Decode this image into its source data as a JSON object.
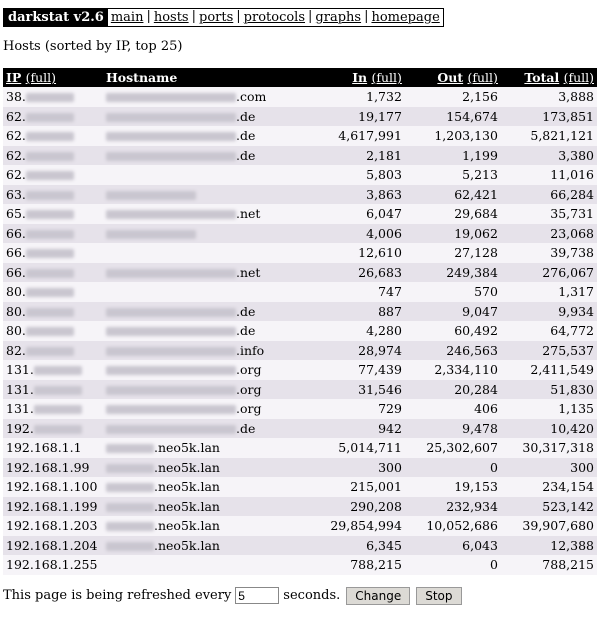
{
  "nav": {
    "brand": "darkstat v2.6",
    "links": [
      "main",
      "hosts",
      "ports",
      "protocols",
      "graphs",
      "homepage"
    ]
  },
  "heading": "Hosts (sorted by IP, top 25)",
  "table": {
    "headers": {
      "ip": "IP",
      "hostname": "Hostname",
      "in": "In",
      "out": "Out",
      "total": "Total",
      "full": "(full)"
    },
    "rows": [
      {
        "ip": "38.",
        "host": ".com",
        "in": "1,732",
        "out": "2,156",
        "total": "3,888"
      },
      {
        "ip": "62.",
        "host": ".de",
        "in": "19,177",
        "out": "154,674",
        "total": "173,851"
      },
      {
        "ip": "62.",
        "host": ".de",
        "in": "4,617,991",
        "out": "1,203,130",
        "total": "5,821,121"
      },
      {
        "ip": "62.",
        "host": ".de",
        "in": "2,181",
        "out": "1,199",
        "total": "3,380"
      },
      {
        "ip": "62.",
        "host": "",
        "in": "5,803",
        "out": "5,213",
        "total": "11,016"
      },
      {
        "ip": "63.",
        "host": "",
        "in": "3,863",
        "out": "62,421",
        "total": "66,284"
      },
      {
        "ip": "65.",
        "host": ".net",
        "in": "6,047",
        "out": "29,684",
        "total": "35,731"
      },
      {
        "ip": "66.",
        "host": "",
        "in": "4,006",
        "out": "19,062",
        "total": "23,068"
      },
      {
        "ip": "66.",
        "host": "",
        "in": "12,610",
        "out": "27,128",
        "total": "39,738"
      },
      {
        "ip": "66.",
        "host": ".net",
        "in": "26,683",
        "out": "249,384",
        "total": "276,067"
      },
      {
        "ip": "80.",
        "host": "",
        "in": "747",
        "out": "570",
        "total": "1,317"
      },
      {
        "ip": "80.",
        "host": ".de",
        "in": "887",
        "out": "9,047",
        "total": "9,934"
      },
      {
        "ip": "80.",
        "host": ".de",
        "in": "4,280",
        "out": "60,492",
        "total": "64,772"
      },
      {
        "ip": "82.",
        "host": ".info",
        "in": "28,974",
        "out": "246,563",
        "total": "275,537"
      },
      {
        "ip": "131.",
        "host": ".org",
        "in": "77,439",
        "out": "2,334,110",
        "total": "2,411,549"
      },
      {
        "ip": "131.",
        "host": ".org",
        "in": "31,546",
        "out": "20,284",
        "total": "51,830"
      },
      {
        "ip": "131.",
        "host": ".org",
        "in": "729",
        "out": "406",
        "total": "1,135"
      },
      {
        "ip": "192.",
        "host": ".de",
        "in": "942",
        "out": "9,478",
        "total": "10,420"
      },
      {
        "ip": "192.168.1.1",
        "host": ".neo5k.lan",
        "in": "5,014,711",
        "out": "25,302,607",
        "total": "30,317,318"
      },
      {
        "ip": "192.168.1.99",
        "host": ".neo5k.lan",
        "in": "300",
        "out": "0",
        "total": "300"
      },
      {
        "ip": "192.168.1.100",
        "host": ".neo5k.lan",
        "in": "215,001",
        "out": "19,153",
        "total": "234,154"
      },
      {
        "ip": "192.168.1.199",
        "host": ".neo5k.lan",
        "in": "290,208",
        "out": "232,934",
        "total": "523,142"
      },
      {
        "ip": "192.168.1.203",
        "host": ".neo5k.lan",
        "in": "29,854,994",
        "out": "10,052,686",
        "total": "39,907,680"
      },
      {
        "ip": "192.168.1.204",
        "host": ".neo5k.lan",
        "in": "6,345",
        "out": "6,043",
        "total": "12,388"
      },
      {
        "ip": "192.168.1.255",
        "host": "",
        "in": "788,215",
        "out": "0",
        "total": "788,215"
      }
    ]
  },
  "footer": {
    "text1": "This page is being refreshed every",
    "interval": "5",
    "text2": "seconds.",
    "change": "Change",
    "stop": "Stop"
  }
}
